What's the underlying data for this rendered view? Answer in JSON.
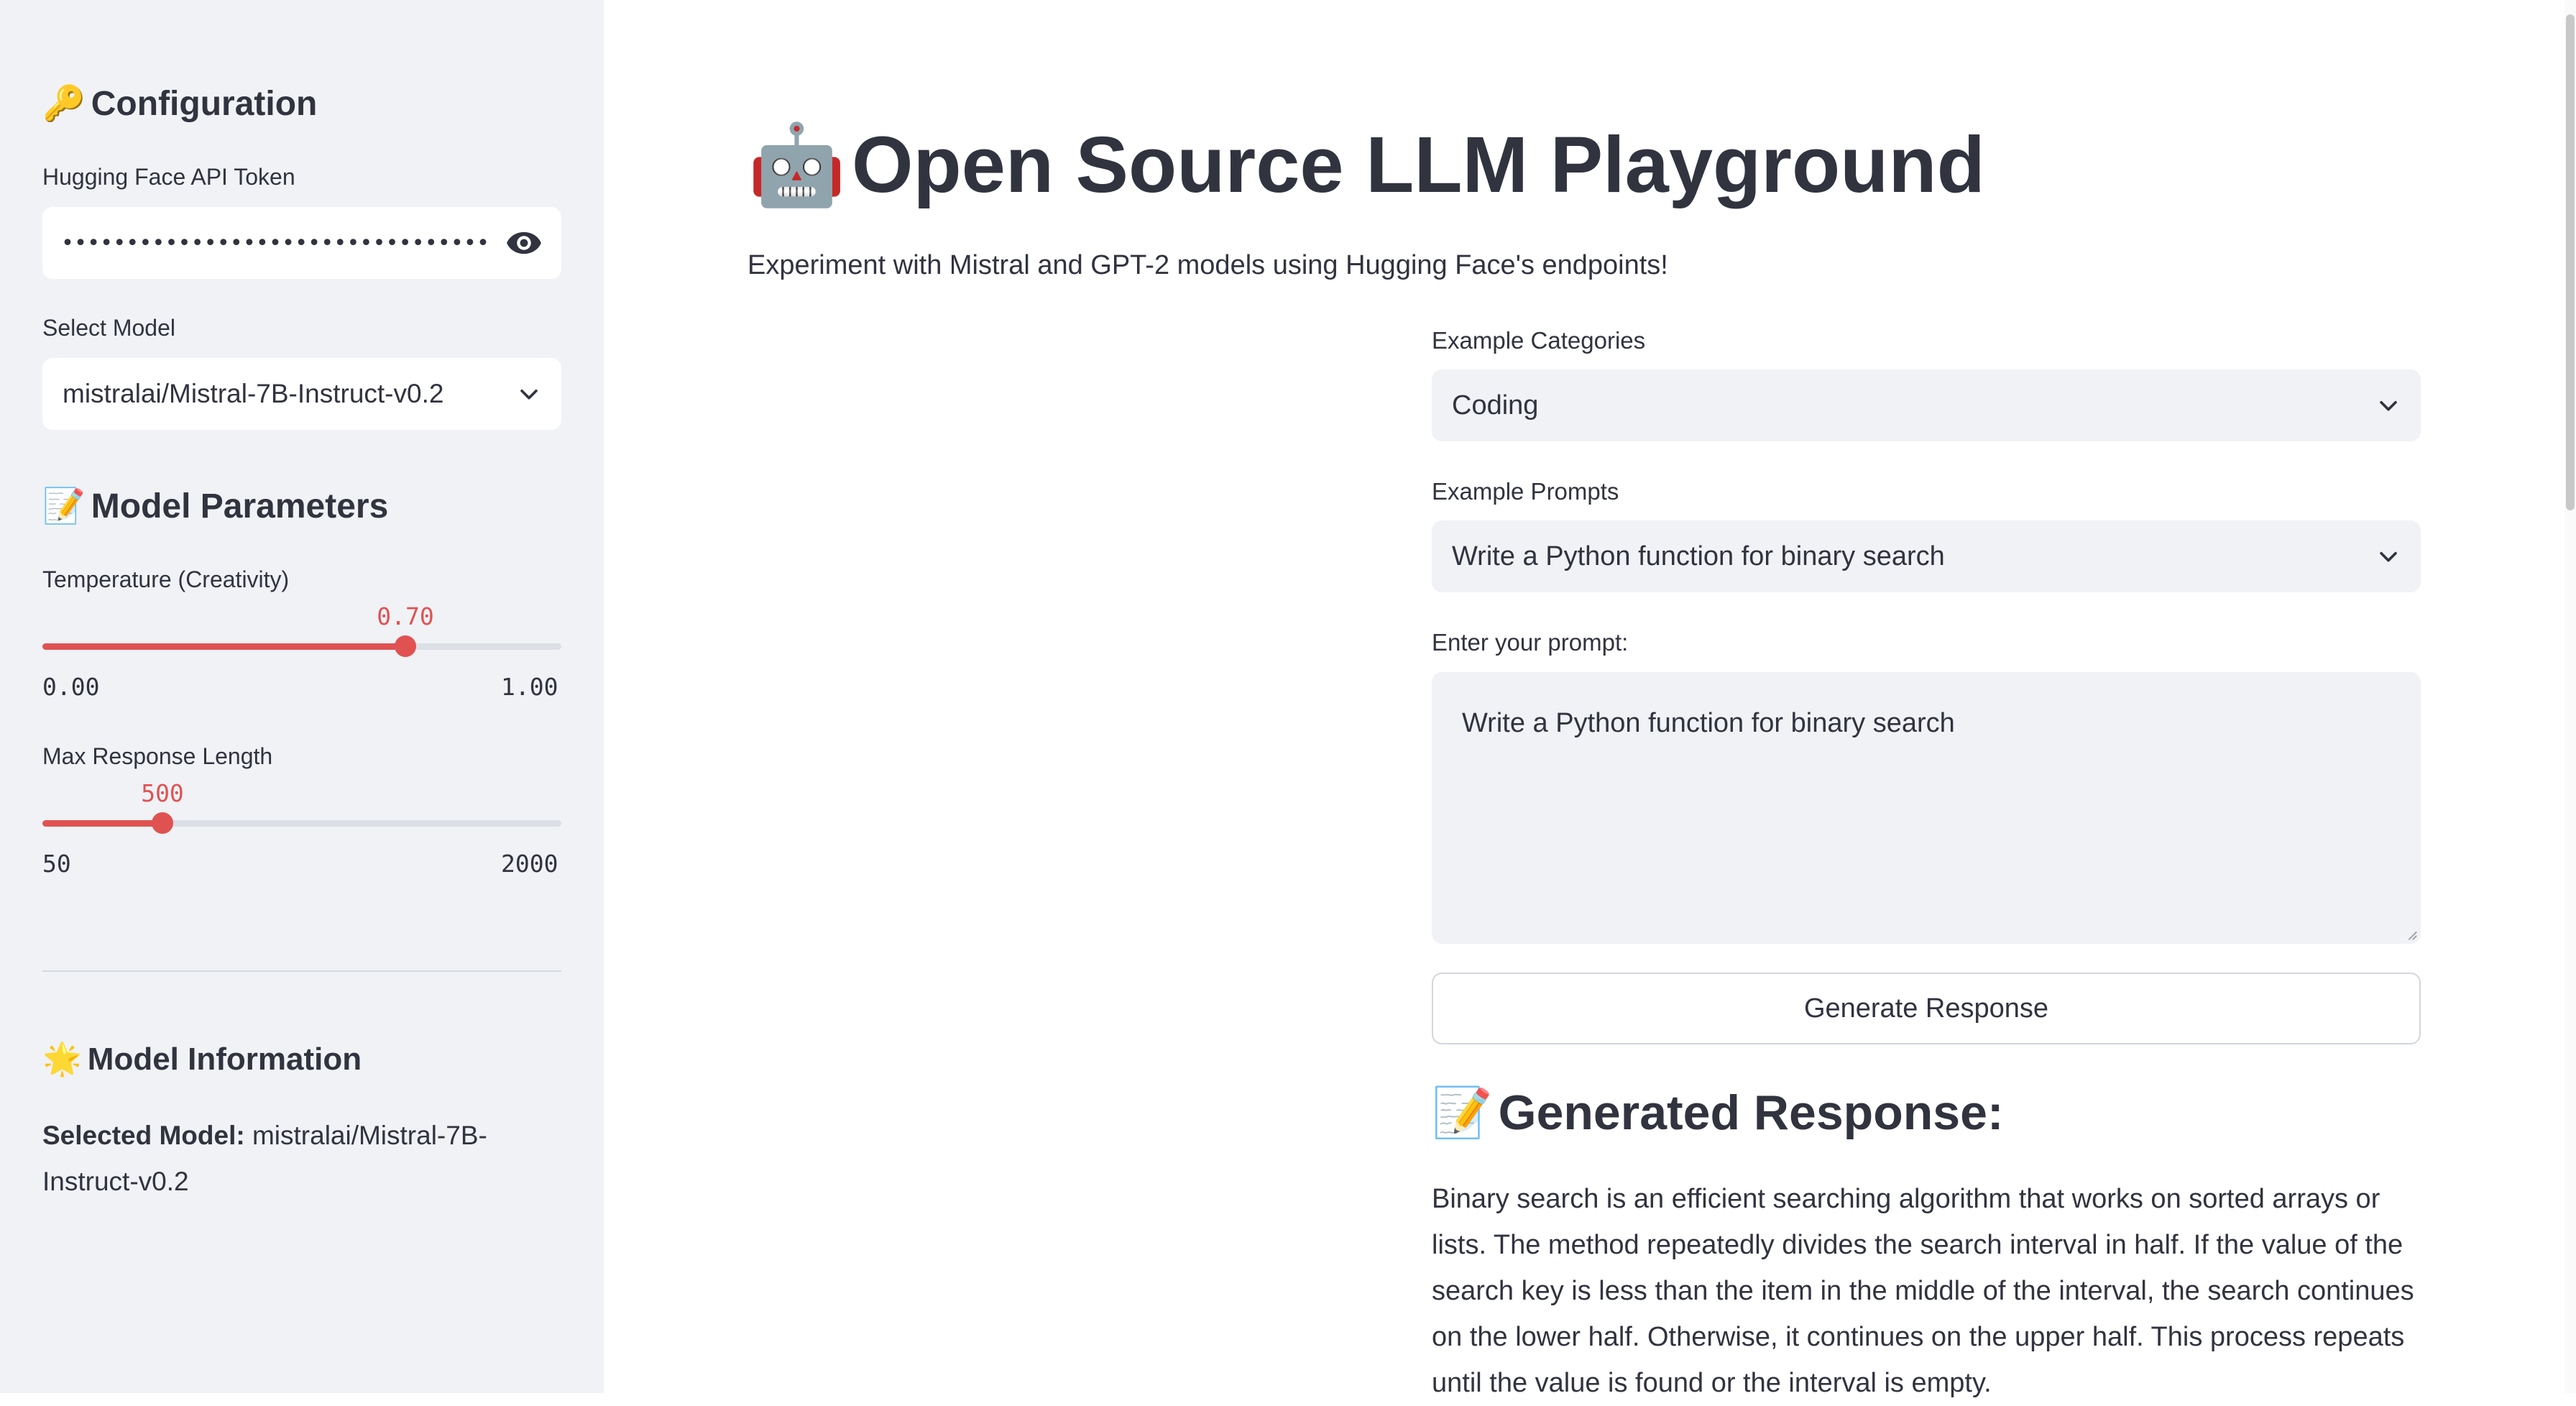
{
  "sidebar": {
    "config_heading": "Configuration",
    "config_emoji": "🔑",
    "token_label": "Hugging Face API Token",
    "token_value": "••••••••••••••••••••••••••••••••••••••",
    "model_label": "Select Model",
    "model_value": "mistralai/Mistral-7B-Instruct-v0.2",
    "params_heading": "Model Parameters",
    "params_emoji": "📝",
    "temperature": {
      "label": "Temperature (Creativity)",
      "value": "0.70",
      "min": "0.00",
      "max": "1.00",
      "fraction": 0.7
    },
    "max_length": {
      "label": "Max Response Length",
      "value": "500",
      "min": "50",
      "max": "2000",
      "fraction": 0.2308
    },
    "info_heading": "Model Information",
    "info_emoji": "🌟",
    "selected_model_label": "Selected Model:",
    "selected_model_value": "mistralai/Mistral-7B-Instruct-v0.2"
  },
  "main": {
    "title_emoji": "🤖",
    "title": "Open Source LLM Playground",
    "subtitle": "Experiment with Mistral and GPT-2 models using Hugging Face's endpoints!",
    "categories_label": "Example Categories",
    "categories_value": "Coding",
    "prompts_label": "Example Prompts",
    "prompts_value": "Write a Python function for binary search",
    "prompt_label": "Enter your prompt:",
    "prompt_value": "Write a Python function for binary search",
    "generate_button": "Generate Response",
    "response_emoji": "📝",
    "response_heading": "Generated Response:",
    "response_text": "Binary search is an efficient searching algorithm that works on sorted arrays or lists. The method repeatedly divides the search interval in half. If the value of the search key is less than the item in the middle of the interval, the search continues on the lower half. Otherwise, it continues on the upper half. This process repeats until the value is found or the interval is empty."
  },
  "colors": {
    "accent": "#e05252",
    "sidebar_bg": "#f0f2f6",
    "text": "#31333f"
  }
}
